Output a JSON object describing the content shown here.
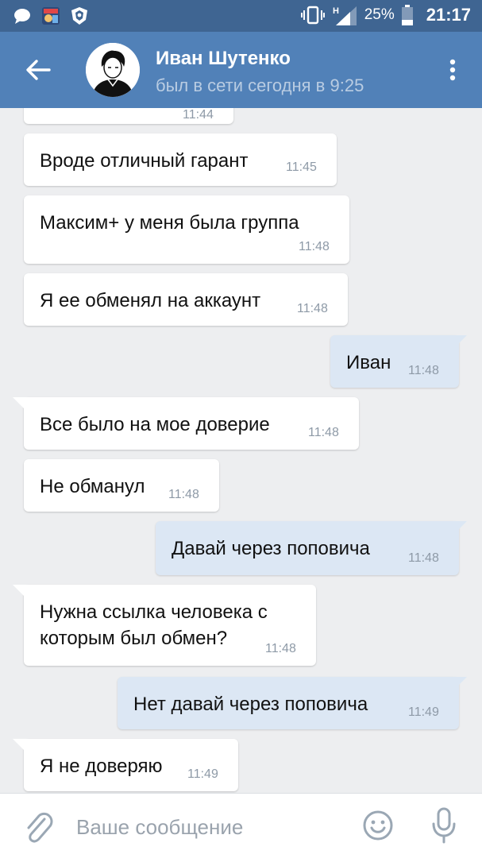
{
  "status_bar": {
    "icons": [
      "chat-bubble-icon",
      "game-app-icon",
      "shield-app-icon",
      "vibrate-icon",
      "signal-icon",
      "battery-icon"
    ],
    "network": "H",
    "battery": "25%",
    "time": "21:17"
  },
  "header": {
    "name": "Иван Шутенко",
    "status": "был в сети сегодня в 9:25",
    "icons": [
      "back-arrow-icon",
      "avatar",
      "more-vertical-icon"
    ]
  },
  "messages": [
    {
      "dir": "in",
      "text": "",
      "time": "11:44",
      "partial": true
    },
    {
      "dir": "in",
      "text": "Вроде отличный гарант",
      "time": "11:45"
    },
    {
      "dir": "in",
      "text": "Максим+ у меня была группа",
      "time": "11:48"
    },
    {
      "dir": "in",
      "text": "Я ее обменял на аккаунт",
      "time": "11:48"
    },
    {
      "dir": "out",
      "text": "Иван",
      "time": "11:48"
    },
    {
      "dir": "in",
      "text": "Все было на мое доверие",
      "time": "11:48"
    },
    {
      "dir": "in",
      "text": "Не обманул",
      "time": "11:48"
    },
    {
      "dir": "out",
      "text": "Давай через поповича",
      "time": "11:48"
    },
    {
      "dir": "in",
      "text_lines": [
        "Нужна ссылка человека с",
        "которым был обмен?"
      ],
      "time": "11:48"
    },
    {
      "dir": "out",
      "text": "Нет давай через поповича",
      "time": "11:49"
    },
    {
      "dir": "in",
      "text": "Я не доверяю",
      "time": "11:49"
    }
  ],
  "input": {
    "placeholder": "Ваше сообщение",
    "icons": [
      "paperclip-icon",
      "emoji-icon",
      "microphone-icon"
    ]
  },
  "colors": {
    "status_bar": "#3f6592",
    "header": "#5181b8",
    "background": "#edeef0",
    "incoming_bubble": "#ffffff",
    "outgoing_bubble": "#dce7f4"
  }
}
